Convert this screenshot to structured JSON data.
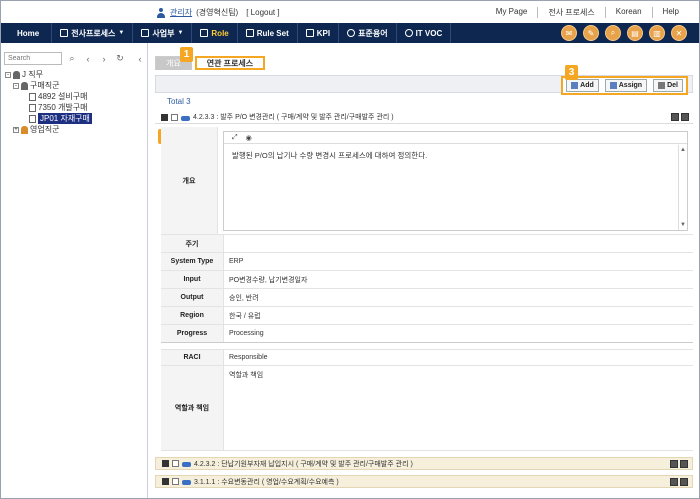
{
  "header": {
    "user_name": "관리자",
    "user_dept": "(경영혁신팀)",
    "logout": "[ Logout ]",
    "links": [
      "My Page",
      "전사 프로세스",
      "Korean",
      "Help"
    ]
  },
  "nav": {
    "items": [
      {
        "label": "Home",
        "icon": "none"
      },
      {
        "label": "전사프로세스",
        "icon": "folder-icon",
        "caret": "▼"
      },
      {
        "label": "사업부",
        "icon": "building-icon",
        "caret": "▼"
      },
      {
        "label": "Role",
        "icon": "role-icon"
      },
      {
        "label": "Rule Set",
        "icon": "ruleset-icon"
      },
      {
        "label": "KPI",
        "icon": "kpi-icon"
      },
      {
        "label": "표준용어",
        "icon": "info-icon"
      },
      {
        "label": "IT VOC",
        "icon": "chat-icon"
      }
    ]
  },
  "left": {
    "search_placeholder": "Search",
    "tree": [
      {
        "label": "J 직무",
        "level": 0
      },
      {
        "label": "구매직군",
        "level": 1
      },
      {
        "label": "4892 설비구매",
        "level": 2
      },
      {
        "label": "7350 개발구매",
        "level": 2
      },
      {
        "label": "JP01 자재구매",
        "level": 2,
        "selected": true
      },
      {
        "label": "영업직군",
        "level": 1
      }
    ]
  },
  "main": {
    "tabs": [
      "개요",
      "연관 프로세스"
    ],
    "badges": [
      "1",
      "2",
      "3"
    ],
    "buttons": {
      "add": "Add",
      "assign": "Assign",
      "del": "Del"
    },
    "total": "Total 3",
    "processes": [
      "4.2.3.3 : 발주 P/O 변경관리 ( 구매/계약 및 발주 관리/구매발주 관리 )",
      "4.2.3.2 : 단납기원부자재 납입지시 ( 구매/계약 및 발주 관리/구매발주 관리 )",
      "3.1.1.1 : 수요변동관리 ( 영업/수요계획/수요예측 )"
    ]
  },
  "detail": {
    "overview_label": "개요",
    "overview_text": "발행된 P/O의 납기나 수량 변경시 프로세스에 대하여 정의한다.",
    "rows": [
      {
        "label": "주기",
        "value": ""
      },
      {
        "label": "System Type",
        "value": "ERP"
      },
      {
        "label": "Input",
        "value": "PO변경수량, 납기변경일자"
      },
      {
        "label": "Output",
        "value": "승인, 반려"
      },
      {
        "label": "Region",
        "value": "한국 / 유럽"
      },
      {
        "label": "Progress",
        "value": "Processing"
      }
    ],
    "raci_label": "RACI",
    "raci_value": "Responsible",
    "role_label": "역할과 책임",
    "role_value": "역할과 책임"
  }
}
